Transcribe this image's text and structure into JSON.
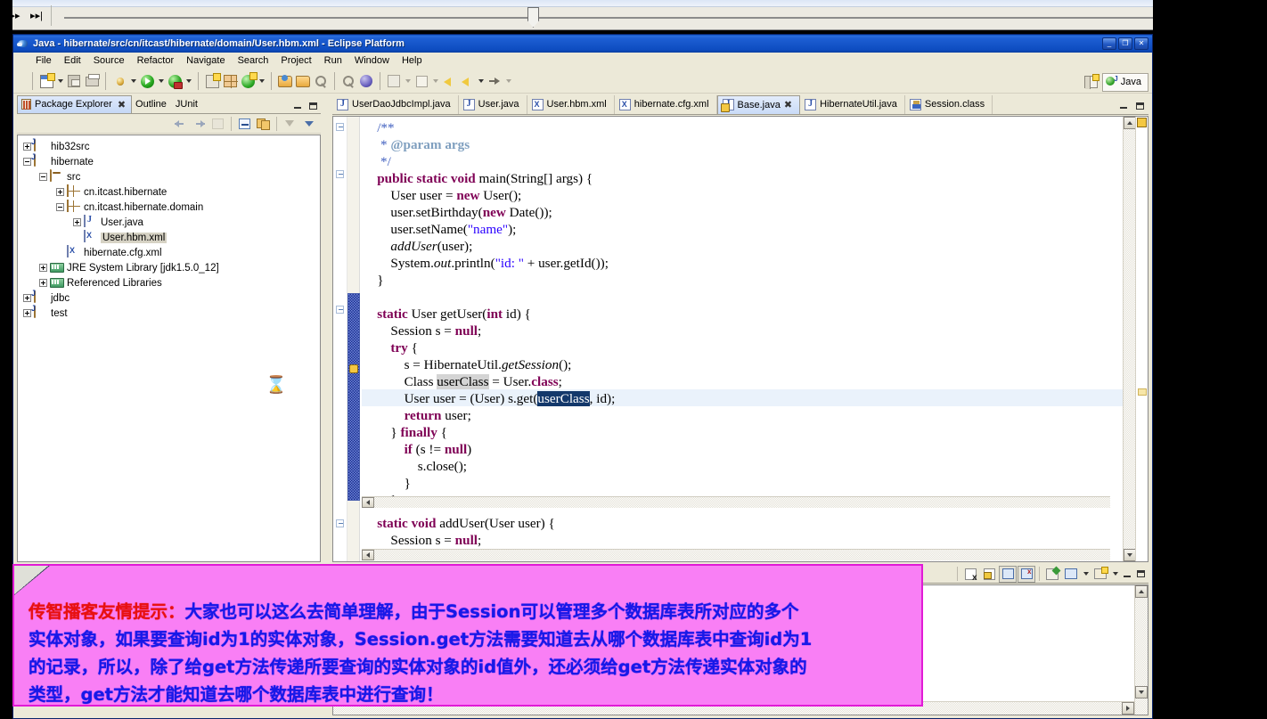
{
  "player": {
    "fast_forward_label": "▸▸",
    "next_track_label": "▸▸|"
  },
  "window": {
    "title": "Java - hibernate/src/cn/itcast/hibernate/domain/User.hbm.xml - Eclipse Platform",
    "minimize_label": "_",
    "restore_label": "❐",
    "close_label": "✕"
  },
  "menubar": {
    "items": [
      {
        "label": "File"
      },
      {
        "label": "Edit"
      },
      {
        "label": "Source"
      },
      {
        "label": "Refactor"
      },
      {
        "label": "Navigate"
      },
      {
        "label": "Search"
      },
      {
        "label": "Project"
      },
      {
        "label": "Run"
      },
      {
        "label": "Window"
      },
      {
        "label": "Help"
      }
    ]
  },
  "toolbar": {
    "icons": [
      "new-file-icon",
      "new-file-dropdown-icon",
      "save-icon",
      "print-icon",
      "debug-icon",
      "debug-dropdown-icon",
      "run-icon",
      "run-dropdown-icon",
      "run-external-icon",
      "run-external-dropdown-icon",
      "new-java-project-icon",
      "new-package-icon",
      "new-class-icon",
      "new-class-dropdown-icon",
      "open-type-icon",
      "open-task-icon",
      "search-icon",
      "next-annotation-icon",
      "previous-annotation-icon",
      "last-edit-location-icon",
      "last-edit-dropdown-icon",
      "back-icon",
      "back-dropdown-icon",
      "forward-icon",
      "forward-dropdown-icon"
    ],
    "perspective": {
      "open_perspective_label": "",
      "active_perspective": "Java"
    }
  },
  "package_explorer": {
    "tabs": [
      {
        "label": "Package Explorer",
        "active": true,
        "closable": true,
        "icon": "package-explorer-icon"
      },
      {
        "label": "Outline",
        "active": false,
        "closable": false,
        "icon": "outline-icon"
      },
      {
        "label": "JUnit",
        "active": false,
        "closable": false,
        "icon": "junit-icon"
      }
    ],
    "view_toolbar": [
      "back-icon",
      "forward-icon",
      "home-icon",
      "collapse-all-icon",
      "link-with-editor-icon",
      "filter-icon",
      "view-menu-icon"
    ],
    "tree": [
      {
        "label": "hib32src",
        "icon": "java-project-icon",
        "indent": 0,
        "expander": "plus"
      },
      {
        "label": "hibernate",
        "icon": "java-project-icon",
        "indent": 0,
        "expander": "minus"
      },
      {
        "label": "src",
        "icon": "source-folder-icon",
        "indent": 1,
        "expander": "minus"
      },
      {
        "label": "cn.itcast.hibernate",
        "icon": "package-icon",
        "indent": 2,
        "expander": "plus"
      },
      {
        "label": "cn.itcast.hibernate.domain",
        "icon": "package-icon",
        "indent": 2,
        "expander": "minus"
      },
      {
        "label": "User.java",
        "icon": "java-file-icon",
        "indent": 3,
        "expander": "plus"
      },
      {
        "label": "User.hbm.xml",
        "icon": "xml-file-icon",
        "indent": 3,
        "expander": "none",
        "selected": true
      },
      {
        "label": "hibernate.cfg.xml",
        "icon": "xml-file-icon",
        "indent": 2,
        "expander": "none"
      },
      {
        "label": "JRE System Library [jdk1.5.0_12]",
        "icon": "library-icon",
        "indent": 1,
        "expander": "plus"
      },
      {
        "label": "Referenced Libraries",
        "icon": "library-icon",
        "indent": 1,
        "expander": "plus"
      },
      {
        "label": "jdbc",
        "icon": "java-project-icon",
        "indent": 0,
        "expander": "plus"
      },
      {
        "label": "test",
        "icon": "java-project-icon",
        "indent": 0,
        "expander": "plus"
      }
    ],
    "cursor": "hourglass-cursor"
  },
  "editor": {
    "tabs": [
      {
        "label": "UserDaoJdbcImpl.java",
        "icon": "java-file-icon",
        "active": false,
        "closable": false
      },
      {
        "label": "User.java",
        "icon": "java-file-icon",
        "active": false,
        "closable": false
      },
      {
        "label": "User.hbm.xml",
        "icon": "xml-file-icon",
        "active": false,
        "closable": false
      },
      {
        "label": "hibernate.cfg.xml",
        "icon": "xml-file-icon",
        "active": false,
        "closable": false
      },
      {
        "label": "Base.java",
        "icon": "java-file-warning-icon",
        "active": true,
        "closable": true
      },
      {
        "label": "HibernateUtil.java",
        "icon": "java-file-icon",
        "active": false,
        "closable": false
      },
      {
        "label": "Session.class",
        "icon": "class-file-icon",
        "active": false,
        "closable": false
      }
    ],
    "code_lines": [
      {
        "indent": 1,
        "segments": [
          {
            "t": "/**",
            "c": "jdoc"
          }
        ]
      },
      {
        "indent": 1,
        "segments": [
          {
            "t": " * ",
            "c": "jdoc"
          },
          {
            "t": "@param",
            "c": "jdoc-tag"
          },
          {
            "t": " args",
            "c": "jdoc-tag"
          }
        ]
      },
      {
        "indent": 1,
        "segments": [
          {
            "t": " */",
            "c": "jdoc"
          }
        ]
      },
      {
        "indent": 1,
        "fold": true,
        "segments": [
          {
            "t": "public static void",
            "c": "kw"
          },
          {
            "t": " main(String[] args) {",
            "c": ""
          }
        ]
      },
      {
        "indent": 2,
        "segments": [
          {
            "t": "User user = ",
            "c": ""
          },
          {
            "t": "new",
            "c": "kw"
          },
          {
            "t": " User();",
            "c": ""
          }
        ]
      },
      {
        "indent": 2,
        "segments": [
          {
            "t": "user.setBirthday(",
            "c": ""
          },
          {
            "t": "new",
            "c": "kw"
          },
          {
            "t": " Date());",
            "c": ""
          }
        ]
      },
      {
        "indent": 2,
        "segments": [
          {
            "t": "user.setName(",
            "c": ""
          },
          {
            "t": "\"name\"",
            "c": "str"
          },
          {
            "t": ");",
            "c": ""
          }
        ]
      },
      {
        "indent": 2,
        "segments": [
          {
            "t": "addUser",
            "c": "stat"
          },
          {
            "t": "(user);",
            "c": ""
          }
        ]
      },
      {
        "indent": 2,
        "segments": [
          {
            "t": "System.",
            "c": ""
          },
          {
            "t": "out",
            "c": "stat"
          },
          {
            "t": ".println(",
            "c": ""
          },
          {
            "t": "\"id: \"",
            "c": "str"
          },
          {
            "t": " + user.getId());",
            "c": ""
          }
        ]
      },
      {
        "indent": 1,
        "segments": [
          {
            "t": "}",
            "c": ""
          }
        ]
      },
      {
        "indent": 0,
        "segments": [
          {
            "t": "",
            "c": ""
          }
        ]
      },
      {
        "indent": 1,
        "fold": true,
        "segments": [
          {
            "t": "static",
            "c": "kw"
          },
          {
            "t": " User getUser(",
            "c": ""
          },
          {
            "t": "int",
            "c": "kw"
          },
          {
            "t": " id) {",
            "c": ""
          }
        ]
      },
      {
        "indent": 2,
        "segments": [
          {
            "t": "Session s = ",
            "c": ""
          },
          {
            "t": "null",
            "c": "kw"
          },
          {
            "t": ";",
            "c": ""
          }
        ]
      },
      {
        "indent": 2,
        "segments": [
          {
            "t": "try",
            "c": "kw"
          },
          {
            "t": " {",
            "c": ""
          }
        ]
      },
      {
        "indent": 3,
        "segments": [
          {
            "t": "s = HibernateUtil.",
            "c": ""
          },
          {
            "t": "getSession",
            "c": "stat"
          },
          {
            "t": "();",
            "c": ""
          }
        ]
      },
      {
        "indent": 3,
        "segments": [
          {
            "t": "Class ",
            "c": ""
          },
          {
            "t": "userClass",
            "c": "occ"
          },
          {
            "t": " = User.",
            "c": ""
          },
          {
            "t": "class",
            "c": "kw"
          },
          {
            "t": ";",
            "c": ""
          }
        ]
      },
      {
        "indent": 3,
        "current": true,
        "segments": [
          {
            "t": "User user = (User) s.get(",
            "c": ""
          },
          {
            "t": "userClass",
            "c": "selhl"
          },
          {
            "t": ", id);",
            "c": ""
          }
        ]
      },
      {
        "indent": 3,
        "segments": [
          {
            "t": "return",
            "c": "kw"
          },
          {
            "t": " user;",
            "c": ""
          }
        ]
      },
      {
        "indent": 2,
        "segments": [
          {
            "t": "} ",
            "c": ""
          },
          {
            "t": "finally",
            "c": "kw"
          },
          {
            "t": " {",
            "c": ""
          }
        ]
      },
      {
        "indent": 3,
        "segments": [
          {
            "t": "if",
            "c": "kw"
          },
          {
            "t": " (s != ",
            "c": ""
          },
          {
            "t": "null",
            "c": "kw"
          },
          {
            "t": ")",
            "c": ""
          }
        ]
      },
      {
        "indent": 4,
        "segments": [
          {
            "t": "s.close();",
            "c": ""
          }
        ]
      },
      {
        "indent": 3,
        "segments": [
          {
            "t": "}",
            "c": ""
          }
        ]
      },
      {
        "indent": 2,
        "segments": [
          {
            "t": "}",
            "c": ""
          }
        ]
      }
    ],
    "code_lines_lower": [
      {
        "indent": 1,
        "fold": true,
        "segments": [
          {
            "t": "static void",
            "c": "kw"
          },
          {
            "t": " addUser(User user) {",
            "c": ""
          }
        ]
      },
      {
        "indent": 2,
        "segments": [
          {
            "t": "Session s = ",
            "c": ""
          },
          {
            "t": "null",
            "c": "kw"
          },
          {
            "t": ";",
            "c": ""
          }
        ]
      }
    ]
  },
  "console_view": {
    "toolbar_icons": [
      "clear-console-icon",
      "lock-scroll-icon",
      "pin-console-icon",
      "terminate-console-icon",
      "display-selected-console-icon",
      "open-console-icon",
      "open-console-dropdown-icon",
      "minimize-icon",
      "maximize-icon"
    ]
  },
  "annotation": {
    "brand": "传智播客友情提示：",
    "line1_rest": "大家也可以这么去简单理解，由于Session可以管理多个数据库表所对应的多个",
    "line2": "实体对象，如果要查询id为1的实体对象，Session.get方法需要知道去从哪个数据库表中查询id为1",
    "line3": "的记录，所以，除了给get方法传递所要查询的实体对象的id值外，还必须给get方法传递实体对象的",
    "line4": "类型，get方法才能知道去哪个数据库表中进行查询！"
  },
  "colors": {
    "title_bar": "#1e5fd4",
    "chrome": "#ece9d8",
    "keyword": "#7f0055",
    "string": "#2a00ff",
    "javadoc": "#3f5fbf",
    "selection": "#13386b",
    "occurrence": "#d4d4d4",
    "current_line": "#eaf2fb",
    "annotation_bg": "#f97ff5",
    "annotation_brand": "#e81010",
    "annotation_body": "#1818e8"
  }
}
